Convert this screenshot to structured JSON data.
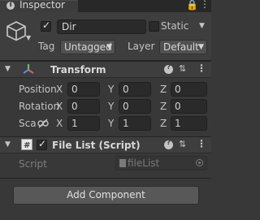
{
  "tab": {
    "title": "Inspector",
    "icon": "info-icon"
  },
  "window_icons": [
    "lock-icon",
    "kebab-menu-icon"
  ],
  "gameobject": {
    "icon": "cube-icon",
    "active": true,
    "name": "Dir",
    "static_label": "Static",
    "tag_label": "Tag",
    "tag_value": "Untagged",
    "layer_label": "Layer",
    "layer_value": "Default"
  },
  "transform": {
    "title": "Transform",
    "rows": [
      {
        "label": "Position",
        "x": "0",
        "y": "0",
        "z": "0"
      },
      {
        "label": "Rotation",
        "x": "0",
        "y": "0",
        "z": "0"
      },
      {
        "label": "Sca",
        "x": "1",
        "y": "1",
        "z": "1"
      }
    ],
    "axes": {
      "x": "X",
      "y": "Y",
      "z": "Z"
    }
  },
  "script_component": {
    "title": "File List (Script)",
    "enabled": true,
    "script_label": "Script",
    "script_value": "fileList"
  },
  "add_component_label": "Add Component",
  "colors": {
    "background": "#383838",
    "header": "#3e3e3e",
    "field": "#2a2a2a",
    "script_title": "#d8d8d8"
  }
}
